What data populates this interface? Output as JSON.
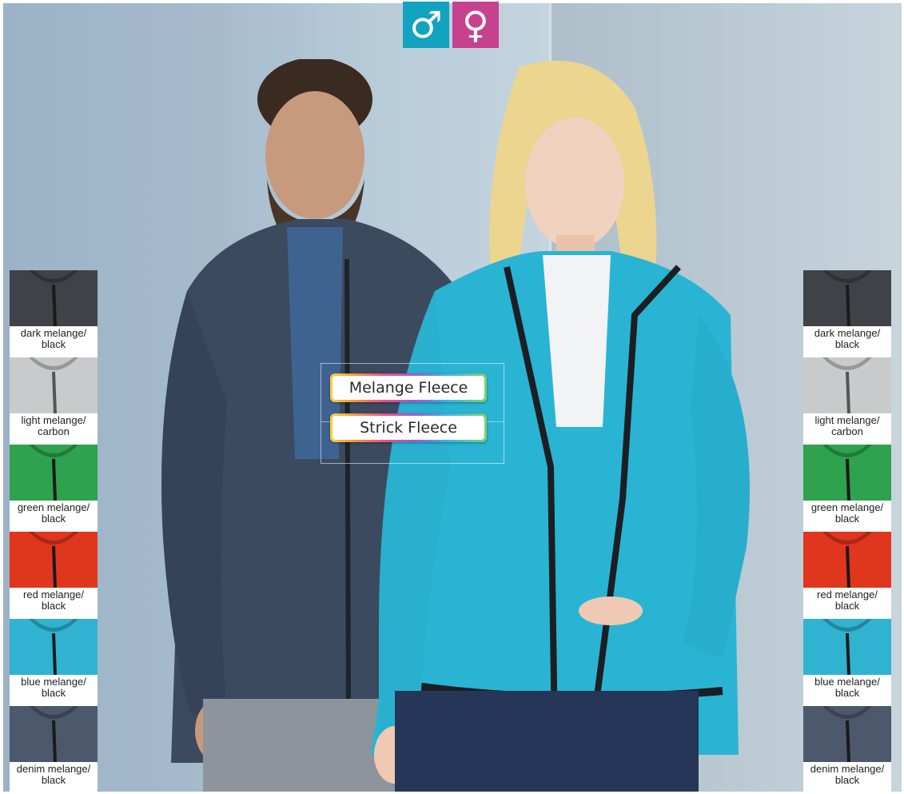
{
  "gender_icons": {
    "male": "♂",
    "female": "♀",
    "male_color": "#11a3c0",
    "female_color": "#c6428f"
  },
  "product_labels": [
    "Melange Fleece",
    "Strick Fleece"
  ],
  "colors": [
    {
      "name": "dark melange/",
      "sub": "black",
      "hex": "#3f4246",
      "zip": "#1a1a1a"
    },
    {
      "name": "light melange/",
      "sub": "carbon",
      "hex": "#c9cacc",
      "zip": "#555555"
    },
    {
      "name": "green melange/",
      "sub": "black",
      "hex": "#2ea24e",
      "zip": "#1a1a1a"
    },
    {
      "name": "red melange/",
      "sub": "black",
      "hex": "#e0361d",
      "zip": "#1a1a1a"
    },
    {
      "name": "blue melange/",
      "sub": "black",
      "hex": "#2fb3d1",
      "zip": "#1a1a1a"
    },
    {
      "name": "denim melange/",
      "sub": "black",
      "hex": "#4c586b",
      "zip": "#1a1a1a"
    }
  ],
  "jacket_colors": {
    "man": "#3b4a5e",
    "woman": "#2ab4d4"
  }
}
